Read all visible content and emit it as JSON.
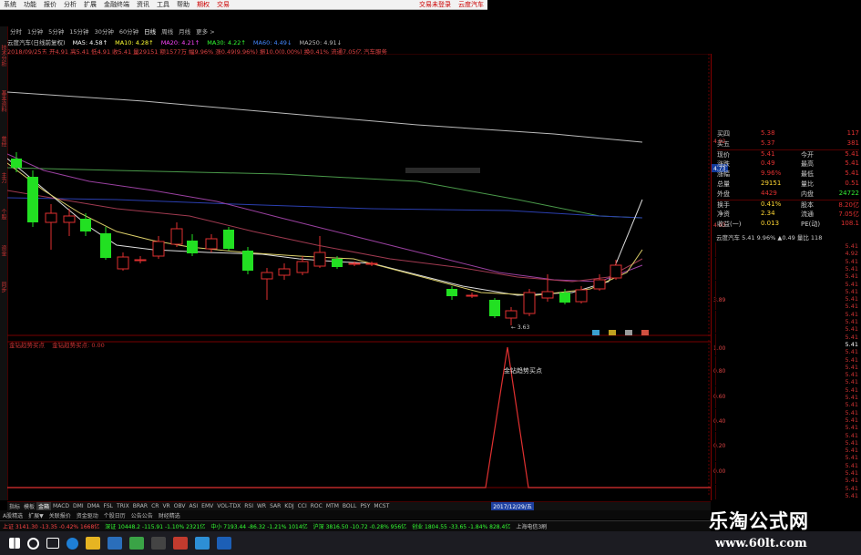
{
  "menu": {
    "items": [
      "系统",
      "功能",
      "报价",
      "分析",
      "扩展",
      "金融终端",
      "资讯",
      "工具",
      "帮助"
    ],
    "red_items": [
      "期权",
      "交易"
    ],
    "right_items": [
      "交易未登录",
      "云度汽车"
    ]
  },
  "periods": [
    "分时",
    "1分钟",
    "5分钟",
    "15分钟",
    "30分钟",
    "60分钟",
    "日线",
    "周线",
    "月线",
    "更多 >"
  ],
  "stock": {
    "title": "云度汽车(日线前复权)",
    "ma": [
      {
        "label": "MA5: 4.58↑",
        "color": "#ffffff"
      },
      {
        "label": "MA10: 4.28↑",
        "color": "#ffff33"
      },
      {
        "label": "MA20: 4.21↑",
        "color": "#ff44ff"
      },
      {
        "label": "MA30: 4.22↑",
        "color": "#33ff33"
      },
      {
        "label": "MA60: 4.49↓",
        "color": "#4488ff"
      },
      {
        "label": "MA250: 4.91↓",
        "color": "#bbbbbb"
      }
    ],
    "info_line": "2018/09/25五 开4.91 高5.41 低4.91 收5.41 量29151 额1577万 幅9.96% 涨0.49(9.96%) 振10.0(0.00%) 换0.41% 流通7.05亿 汽车服务"
  },
  "sidebar_labels": [
    "技术分析",
    "基本资料",
    "曾经",
    "主力",
    "个股",
    "资金",
    "同步"
  ],
  "chart": {
    "price_labels": [
      "4.92",
      "4.73",
      "4.43",
      "3.89",
      "3.63"
    ],
    "low_annotation": "3.63",
    "signal_boxes": [
      "换",
      "财",
      "风",
      "险"
    ]
  },
  "sub": {
    "title": "金钻趋势买点",
    "values": "金钻趋势买点: 0.00",
    "peak_label": "金钻趋势买点",
    "axis": [
      "1.00",
      "0.80",
      "0.60",
      "0.40",
      "0.20",
      "0.00"
    ]
  },
  "quote": {
    "rows": [
      {
        "l": "买四",
        "v": "5.38",
        "r": "",
        "rv": "117"
      },
      {
        "l": "买五",
        "v": "5.37",
        "r": "",
        "rv": "381"
      },
      {
        "l": "现价",
        "v": "5.41",
        "r": "今开",
        "rv": "5.41"
      },
      {
        "l": "涨跌",
        "v": "0.49",
        "r": "最高",
        "rv": "5.41"
      },
      {
        "l": "涨幅",
        "v": "9.96%",
        "r": "最低",
        "rv": "5.41"
      },
      {
        "l": "总量",
        "v": "29151",
        "r": "量比",
        "rv": "0.51"
      },
      {
        "l": "外盘",
        "v": "4429",
        "r": "内盘",
        "rv": "24722"
      },
      {
        "l": "换手",
        "v": "0.41%",
        "r": "股本",
        "rv": "8.20亿"
      },
      {
        "l": "净资",
        "v": "2.34",
        "r": "流通",
        "rv": "7.05亿"
      },
      {
        "l": "收益(一)",
        "v": "0.013",
        "r": "PE(动)",
        "rv": "108.1"
      }
    ],
    "header": "云度汽车  5.41 9.96% ▲0.49 量比 118"
  },
  "ticks": [
    "5.41",
    "4.92",
    "5.41",
    "5.41",
    "5.41",
    "5.41",
    "5.41",
    "5.41",
    "5.41",
    "5.41",
    "5.41",
    "5.41",
    "5.41",
    "5.41",
    "5.41",
    "5.41",
    "5.41",
    "5.41",
    "5.41",
    "5.41",
    "5.41",
    "5.41",
    "5.41",
    "5.41",
    "5.41",
    "5.41",
    "5.41",
    "5.41",
    "5.41",
    "5.41",
    "5.41",
    "5.41",
    "5.41",
    "5.41"
  ],
  "tabs": [
    "指标",
    "模板",
    "金箱",
    "MACD",
    "DMI",
    "DMA",
    "FSL",
    "TRIX",
    "BRAR",
    "CR",
    "VR",
    "OBV",
    "ASI",
    "EMV",
    "VOL-TDX",
    "RSI",
    "WR",
    "SAR",
    "KDJ",
    "CCI",
    "ROC",
    "MTM",
    "BOLL",
    "PSY",
    "MCST"
  ],
  "date_marker": "2017/12/29/五",
  "bottom_tabs": [
    "A股精选",
    "扩展▼",
    "关联报价",
    "资金驱动",
    "个股日历",
    "公告公告",
    "财经精选"
  ],
  "status": [
    {
      "t": "上证 3141.30 -13.35 -0.42% 1668亿",
      "c": "#ff4444"
    },
    {
      "t": "深证 10448.2 -115.91 -1.10% 2321亿",
      "c": "#33ff33"
    },
    {
      "t": "中小 7193.44 -86.32 -1.21% 1014亿",
      "c": "#33ff33"
    },
    {
      "t": "沪深 3816.50 -10.72 -0.28% 956亿",
      "c": "#33ff33"
    },
    {
      "t": "创业 1804.55 -33.65 -1.84% 828.4亿",
      "c": "#33ff33"
    },
    {
      "t": "上海电信3刷",
      "c": "#cccccc"
    }
  ],
  "watermark": {
    "line1": "乐淘公式网",
    "line2": "www.60lt.com"
  }
}
